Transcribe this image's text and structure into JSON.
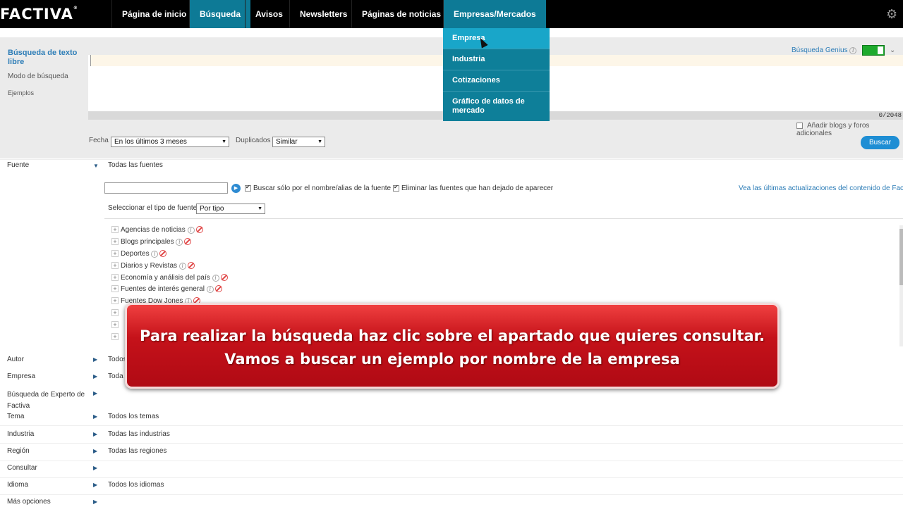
{
  "nav": {
    "logo": "FACTIVA",
    "items": [
      "Página de inicio",
      "Búsqueda",
      "Avisos",
      "Newsletters",
      "Páginas de noticias",
      "Empresas/Mercados"
    ],
    "dropdown": [
      "Empresa",
      "Industria",
      "Cotizaciones",
      "Gráfico de datos de mercado"
    ]
  },
  "search": {
    "free_text_title": "Búsqueda de texto libre",
    "mode": "Modo de búsqueda",
    "examples": "Ejemplos",
    "genius_label": "Búsqueda Genius",
    "counter": "0/2048",
    "add_blogs": "Añadir blogs y foros adicionales",
    "fecha_label": "Fecha",
    "fecha_value": "En los últimos 3 meses",
    "dup_label": "Duplicados",
    "dup_value": "Similar",
    "buscar": "Buscar"
  },
  "fuente": {
    "label": "Fuente",
    "value": "Todas las fuentes",
    "opt_name_only": "Buscar sólo por el nombre/alias de la fuente",
    "opt_remove": "Eliminar las fuentes que han dejado de aparecer",
    "latest_link": "Vea las últimas actualizaciones del contenido de Factiva",
    "type_label": "Seleccionar el tipo de fuente",
    "type_value": "Por tipo",
    "items": [
      "Agencias de noticias",
      "Blogs principales",
      "Deportes",
      "Diarios y Revistas",
      "Economía y análisis del país",
      "Fuentes de interés general",
      "Fuentes Dow Jones"
    ]
  },
  "rows": [
    {
      "label": "Autor",
      "value": "Todos"
    },
    {
      "label": "Empresa",
      "value": "Toda"
    },
    {
      "label": "Búsqueda de Experto de Factiva",
      "value": ""
    },
    {
      "label": "Tema",
      "value": "Todos los temas"
    },
    {
      "label": "Industria",
      "value": "Todas las industrias"
    },
    {
      "label": "Región",
      "value": "Todas las regiones"
    },
    {
      "label": "Consultar",
      "value": ""
    },
    {
      "label": "Idioma",
      "value": "Todos los idiomas"
    },
    {
      "label": "Más opciones",
      "value": ""
    }
  ],
  "banner": {
    "line1": "Para realizar la búsqueda haz clic sobre el apartado que quieres consultar.",
    "line2": "Vamos a buscar un ejemplo por nombre de la empresa"
  },
  "colors": {
    "nav_bg": "#000000",
    "active_tab": "#0d7a96",
    "banner": "#c5121a",
    "link": "#2d7db7"
  }
}
